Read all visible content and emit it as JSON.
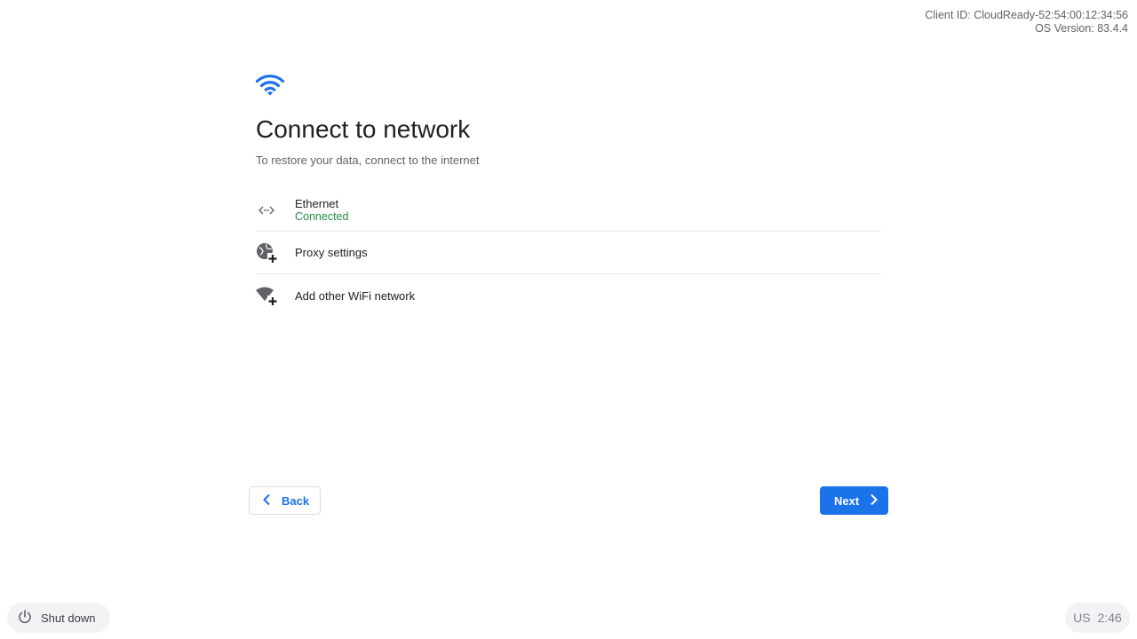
{
  "device_info": {
    "client_id": "Client ID: CloudReady-52:54:00:12:34:56",
    "os_version": "OS Version: 83.4.4"
  },
  "dialog": {
    "icon": "wifi-icon",
    "title": "Connect to network",
    "subtitle": "To restore your data, connect to the internet"
  },
  "networks": [
    {
      "icon": "ethernet-icon",
      "label": "Ethernet",
      "status": "Connected"
    },
    {
      "icon": "proxy-settings-icon",
      "label": "Proxy settings"
    },
    {
      "icon": "add-wifi-icon",
      "label": "Add other WiFi network"
    }
  ],
  "buttons": {
    "back": "Back",
    "next": "Next"
  },
  "shelf": {
    "shutdown_label": "Shut down",
    "keyboard_layout": "US",
    "time": "2:46"
  },
  "colors": {
    "accent": "#1a73e8",
    "status_connected": "#1e8e3e"
  }
}
